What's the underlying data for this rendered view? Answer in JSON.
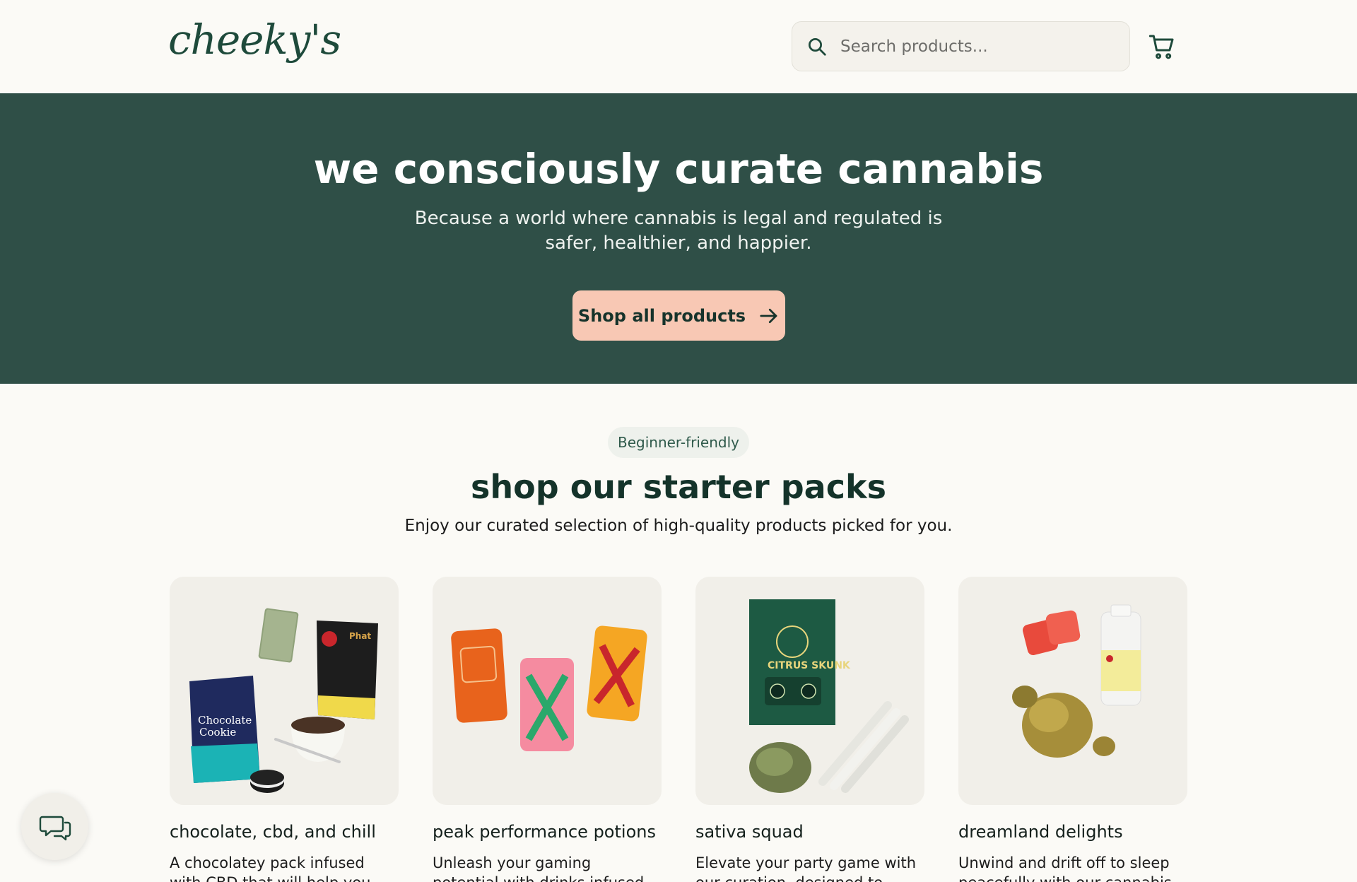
{
  "header": {
    "logo_text": "cheeky's",
    "search_placeholder": "Search products...",
    "search_icon": "search-icon",
    "cart_icon": "cart-icon"
  },
  "hero": {
    "title": "we consciously curate cannabis",
    "subtitle": "Because a world where cannabis is legal and regulated is safer, healthier, and happier.",
    "cta_label": "Shop all products",
    "cta_icon": "arrow-right-icon"
  },
  "section": {
    "badge": "Beginner-friendly",
    "title": "shop our starter packs",
    "subtitle": "Enjoy our curated selection of high-quality products picked for you."
  },
  "cards": [
    {
      "title": "chocolate, cbd, and chill",
      "description": "A chocolatey pack infused with CBD that will help you unwind"
    },
    {
      "title": "peak performance potions",
      "description": "Unleash your gaming potential with drinks infused with cannabis"
    },
    {
      "title": "sativa squad",
      "description": "Elevate your party game with our curation, designed to provide a"
    },
    {
      "title": "dreamland delights",
      "description": "Unwind and drift off to sleep peacefully with our cannabis"
    }
  ],
  "chat_icon": "chat-bubbles-icon",
  "colors": {
    "hero_bg": "#2f4f47",
    "cta_bg": "#f8c8b4",
    "page_bg": "#fbfaf6",
    "brand_dark": "#14332a"
  }
}
